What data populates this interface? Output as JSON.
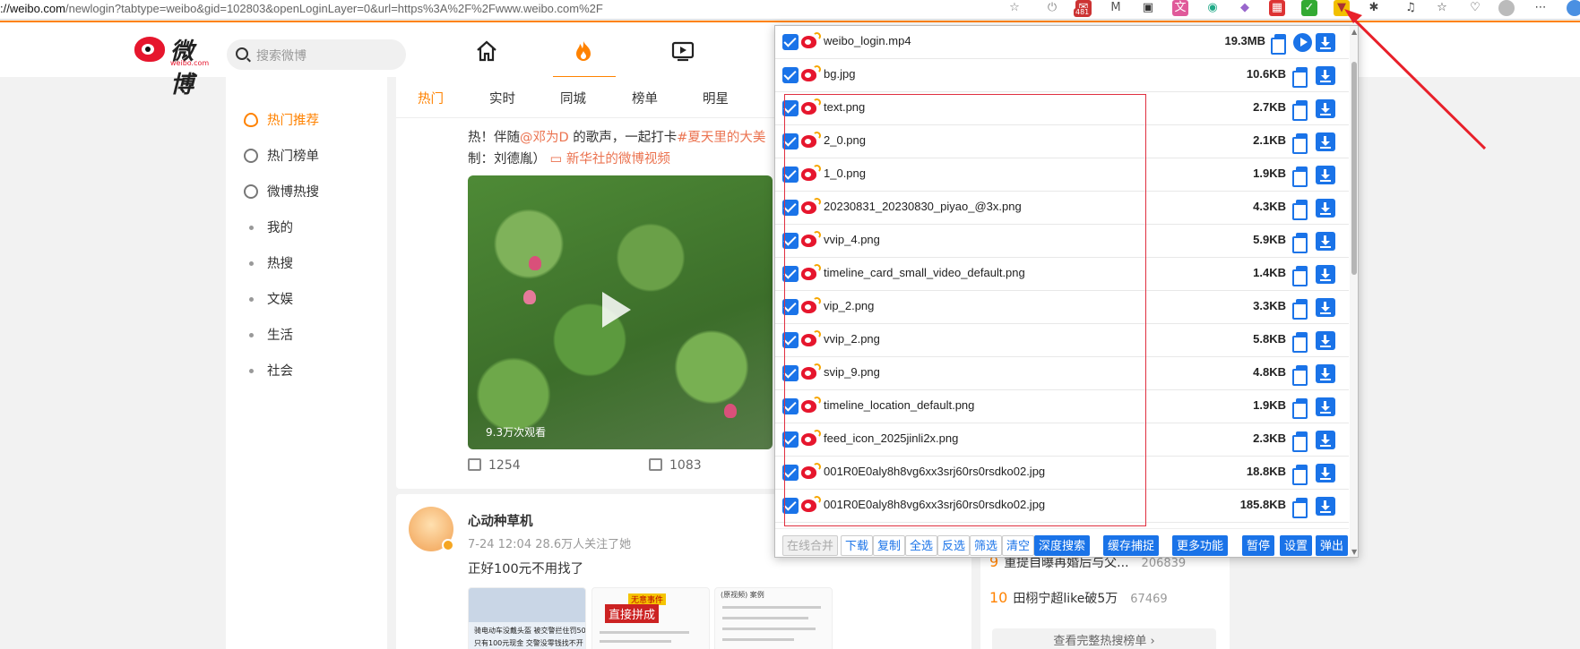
{
  "browser": {
    "url_host": "://weibo.com",
    "url_path": "/newlogin?tabtype=weibo&gid=102803&openLoginLayer=0&url=https%3A%2F%2Fwww.weibo.com%2F",
    "mail_badge": "481"
  },
  "header": {
    "logo_text": "微博",
    "logo_sub": "weibo.com",
    "search_placeholder": "搜索微博",
    "accent_color": "#ff8200"
  },
  "left_nav": {
    "items": [
      {
        "label": "热门推荐",
        "icon": "fire-icon",
        "active": true
      },
      {
        "label": "热门榜单",
        "icon": "clock-icon"
      },
      {
        "label": "微博热搜",
        "icon": "search-icon"
      },
      {
        "label": "我的"
      },
      {
        "label": "热搜"
      },
      {
        "label": "文娱"
      },
      {
        "label": "生活"
      },
      {
        "label": "社会"
      }
    ]
  },
  "feed": {
    "tabs": [
      "热门",
      "实时",
      "同城",
      "榜单",
      "明星"
    ],
    "post1": {
      "line1_a": "热！伴随",
      "line1_mention": "@邓为D",
      "line1_b": " 的歌声，一起打卡",
      "line1_tag": "#夏天里的大美",
      "line2_a": "制：刘德胤）",
      "line2_link": "新华社的微博视频",
      "views": "9.3万次观看",
      "reposts": "1254",
      "comments": "1083"
    },
    "post2": {
      "author": "心动种草机",
      "meta": "7-24 12:04  28.6万人关注了她",
      "text": "正好100元不用找了",
      "thumb1_text": "骑电动车没戴头盔 被交警拦住罚50",
      "thumb1_text2": "只有100元现金 交警没零钱找不开",
      "thumb2_text": "直接拼成",
      "thumb2_badge": "无意事件",
      "thumb3_text": "(原视频) 案例"
    }
  },
  "hot": {
    "rows": [
      {
        "rank": "9",
        "title": "重提自曝再婚后与父...",
        "count": "206839"
      },
      {
        "rank": "10",
        "title": "田栩宁超like破5万",
        "count": "67469"
      }
    ],
    "more_label": "查看完整热搜榜单  ›"
  },
  "popup": {
    "files": [
      {
        "name": "weibo_login.mp4",
        "size": "19.3MB",
        "video": true
      },
      {
        "name": "bg.jpg",
        "size": "10.6KB"
      },
      {
        "name": "text.png",
        "size": "2.7KB"
      },
      {
        "name": "2_0.png",
        "size": "2.1KB"
      },
      {
        "name": "1_0.png",
        "size": "1.9KB"
      },
      {
        "name": "20230831_20230830_piyao_@3x.png",
        "size": "4.3KB"
      },
      {
        "name": "vvip_4.png",
        "size": "5.9KB"
      },
      {
        "name": "timeline_card_small_video_default.png",
        "size": "1.4KB"
      },
      {
        "name": "vip_2.png",
        "size": "3.3KB"
      },
      {
        "name": "vvip_2.png",
        "size": "5.8KB"
      },
      {
        "name": "svip_9.png",
        "size": "4.8KB"
      },
      {
        "name": "timeline_location_default.png",
        "size": "1.9KB"
      },
      {
        "name": "feed_icon_2025jinli2x.png",
        "size": "2.3KB"
      },
      {
        "name": "001R0E0aly8h8vg6xx3srj60rs0rsdko02.jpg",
        "size": "18.8KB"
      },
      {
        "name": "001R0E0aly8h8vg6xx3srj60rs0rsdko02.jpg",
        "size": "185.8KB"
      }
    ],
    "toolbar": [
      "在线合并",
      "下载",
      "复制",
      "全选",
      "反选",
      "筛选",
      "清空",
      "深度搜索",
      "缓存捕捉",
      "更多功能",
      "暂停",
      "设置",
      "弹出"
    ],
    "checkbox_color": "#1a73e8",
    "highlight_color": "#e03040"
  }
}
